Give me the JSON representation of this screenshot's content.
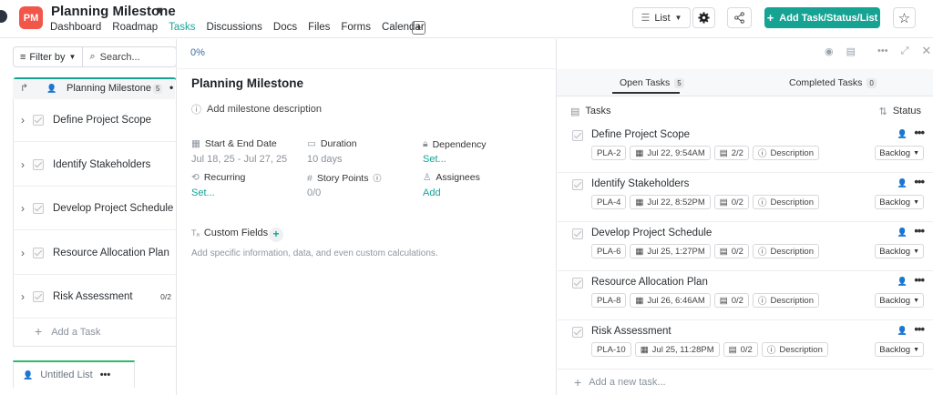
{
  "app": {
    "logo_text": "PM",
    "project_title": "Planning Milestone",
    "nav": [
      "Dashboard",
      "Roadmap",
      "Tasks",
      "Discussions",
      "Docs",
      "Files",
      "Forms",
      "Calendar"
    ],
    "active_nav": "Tasks",
    "view_label": "List",
    "add_button_label": "Add Task/Status/List"
  },
  "left": {
    "filter_label": "Filter by",
    "search_placeholder": "Search...",
    "group_title": "Planning Milestone",
    "group_count": "5",
    "items": [
      {
        "label": "Define Project Scope"
      },
      {
        "label": "Identify Stakeholders"
      },
      {
        "label": "Develop Project Schedule"
      },
      {
        "label": "Resource Allocation Plan"
      },
      {
        "label": "Risk Assessment",
        "subtask": "0/2"
      }
    ],
    "add_task": "Add a Task",
    "untitled_list": "Untitled List"
  },
  "middle": {
    "progress": "0%",
    "title": "Planning Milestone",
    "desc_placeholder": "Add milestone description",
    "fields": {
      "dates_label": "Start & End Date",
      "dates_value": "Jul 18, 25 - Jul 27, 25",
      "duration_label": "Duration",
      "duration_value": "10 days",
      "dependency_label": "Dependency",
      "dependency_value": "Set...",
      "recurring_label": "Recurring",
      "recurring_value": "Set...",
      "points_label": "Story Points",
      "points_value": "0/0",
      "assignees_label": "Assignees",
      "assignees_value": "Add"
    },
    "custom_fields_label": "Custom Fields",
    "custom_fields_note": "Add specific information, data, and even custom calculations."
  },
  "right": {
    "open_tab": "Open Tasks",
    "open_count": "5",
    "completed_tab": "Completed Tasks",
    "completed_count": "0",
    "tasks_header": "Tasks",
    "status_header": "Status",
    "tasks": [
      {
        "name": "Define Project Scope",
        "id": "PLA-2",
        "date": "Jul 22, 9:54AM",
        "sub": "2/2",
        "desc": "Description",
        "status": "Backlog"
      },
      {
        "name": "Identify Stakeholders",
        "id": "PLA-4",
        "date": "Jul 22, 8:52PM",
        "sub": "0/2",
        "desc": "Description",
        "status": "Backlog"
      },
      {
        "name": "Develop Project Schedule",
        "id": "PLA-6",
        "date": "Jul 25, 1:27PM",
        "sub": "0/2",
        "desc": "Description",
        "status": "Backlog"
      },
      {
        "name": "Resource Allocation Plan",
        "id": "PLA-8",
        "date": "Jul 26, 6:46AM",
        "sub": "0/2",
        "desc": "Description",
        "status": "Backlog"
      },
      {
        "name": "Risk Assessment",
        "id": "PLA-10",
        "date": "Jul 25, 11:28PM",
        "sub": "0/2",
        "desc": "Description",
        "status": "Backlog"
      }
    ],
    "add_new": "Add a new task..."
  }
}
